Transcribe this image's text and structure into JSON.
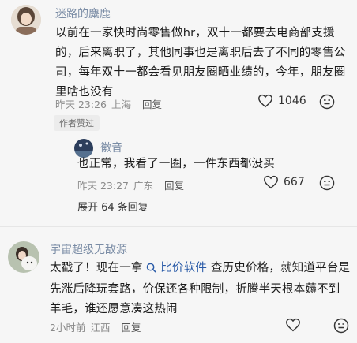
{
  "comments": [
    {
      "username": "迷路的麋鹿",
      "lines": [
        "以前在一家快时尚零售做hr，双十一都要去电商部支援",
        "的，后来离职了，其他同事也是离职后去了不同的零售公",
        "司，每年双十一都会看见朋友圈晒业绩的，今年，朋友圈",
        "里啥也没有"
      ],
      "time": "昨天 23:26",
      "location": "上海",
      "reply_label": "回复",
      "likes": "1046",
      "badge": "作者赞过"
    },
    {
      "username": "徽音",
      "lines": [
        "也正常，我看了一圈，一件东西都没买"
      ],
      "time": "昨天 23:27",
      "location": "广东",
      "reply_label": "回复",
      "likes": "667",
      "expand_label": "展开 64 条回复"
    },
    {
      "username": "宇宙超级无敌源",
      "line1_before": "太戳了！现在一拿",
      "line1_link": "比价软件",
      "line1_after": "查历史价格，就知道平台是",
      "lines": [
        "先涨后降玩套路，价保还各种限制，折腾半天根本薅不到",
        "羊毛，谁还愿意凑这热闹"
      ],
      "time": "2小时前",
      "location": "江西",
      "reply_label": "回复"
    }
  ]
}
